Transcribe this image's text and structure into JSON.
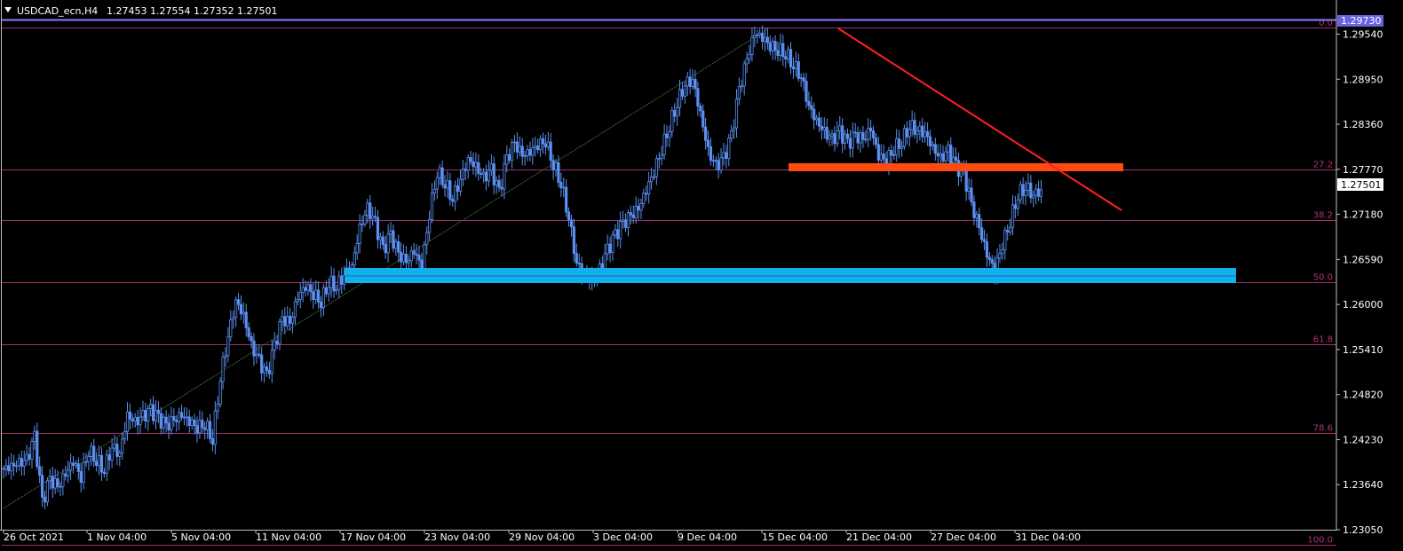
{
  "header": {
    "symbol_label": "USDCAD_ecn,H4",
    "quotes": "1.27453 1.27554 1.27352 1.27501",
    "collapse_icon": "triangle-down-icon"
  },
  "colors": {
    "background": "#000000",
    "candle": "#5b8ff0",
    "fib": "#a0306f",
    "top_line": "#8a7cff",
    "trendline": "#ff2020",
    "resistance_zone": "#ff4a10",
    "support_zone": "#12b0ee",
    "text": "#ffffff",
    "fib_text": "#b0357a",
    "current_price_box": "#ffffff",
    "top_price_box": "#6a62e0"
  },
  "chart_data": {
    "type": "candlestick",
    "symbol": "USDCAD_ecn",
    "timeframe": "H4",
    "ylim": [
      1.2285,
      1.2985
    ],
    "y_ticks": [
      "1.29540",
      "1.28950",
      "1.28360",
      "1.27770",
      "1.27180",
      "1.26590",
      "1.26000",
      "1.25410",
      "1.24820",
      "1.24230",
      "1.23640",
      "1.23050"
    ],
    "x_ticks": [
      "26 Oct 2021",
      "1 Nov 04:00",
      "5 Nov 04:00",
      "11 Nov 04:00",
      "17 Nov 04:00",
      "23 Nov 04:00",
      "29 Nov 04:00",
      "3 Dec 04:00",
      "9 Dec 04:00",
      "15 Dec 04:00",
      "21 Dec 04:00",
      "27 Dec 04:00",
      "31 Dec 04:00"
    ],
    "last_price": "1.27501",
    "top_price": "1.29730",
    "close_path": [
      [
        0,
        1.2385
      ],
      [
        3,
        1.2395
      ],
      [
        4,
        1.2425
      ],
      [
        5,
        1.234
      ],
      [
        6,
        1.237
      ],
      [
        7,
        1.236
      ],
      [
        9,
        1.2395
      ],
      [
        10,
        1.2375
      ],
      [
        11,
        1.241
      ],
      [
        13,
        1.2385
      ],
      [
        14,
        1.2415
      ],
      [
        15,
        1.2405
      ],
      [
        16,
        1.2455
      ],
      [
        17,
        1.2445
      ],
      [
        19,
        1.246
      ],
      [
        21,
        1.244
      ],
      [
        23,
        1.2455
      ],
      [
        25,
        1.244
      ],
      [
        26,
        1.2445
      ],
      [
        27,
        1.2425
      ],
      [
        28,
        1.2505
      ],
      [
        29,
        1.256
      ],
      [
        30,
        1.2605
      ],
      [
        31,
        1.2585
      ],
      [
        32,
        1.2545
      ],
      [
        33,
        1.2525
      ],
      [
        34,
        1.2505
      ],
      [
        35,
        1.2545
      ],
      [
        36,
        1.258
      ],
      [
        37,
        1.2575
      ],
      [
        38,
        1.261
      ],
      [
        39,
        1.2625
      ],
      [
        40,
        1.2615
      ],
      [
        41,
        1.2605
      ],
      [
        42,
        1.263
      ],
      [
        43,
        1.2625
      ],
      [
        44,
        1.264
      ],
      [
        45,
        1.265
      ],
      [
        46,
        1.27
      ],
      [
        47,
        1.2725
      ],
      [
        48,
        1.2705
      ],
      [
        49,
        1.267
      ],
      [
        50,
        1.269
      ],
      [
        51,
        1.2665
      ],
      [
        52,
        1.2655
      ],
      [
        53,
        1.267
      ],
      [
        54,
        1.265
      ],
      [
        55,
        1.272
      ],
      [
        56,
        1.2775
      ],
      [
        57,
        1.276
      ],
      [
        58,
        1.274
      ],
      [
        59,
        1.2765
      ],
      [
        60,
        1.279
      ],
      [
        61,
        1.278
      ],
      [
        62,
        1.2765
      ],
      [
        63,
        1.2775
      ],
      [
        64,
        1.2745
      ],
      [
        65,
        1.279
      ],
      [
        66,
        1.281
      ],
      [
        67,
        1.2795
      ],
      [
        68,
        1.28
      ],
      [
        69,
        1.281
      ],
      [
        70,
        1.2815
      ],
      [
        71,
        1.2785
      ],
      [
        72,
        1.276
      ],
      [
        73,
        1.2715
      ],
      [
        74,
        1.2655
      ],
      [
        75,
        1.264
      ],
      [
        76,
        1.263
      ],
      [
        77,
        1.2645
      ],
      [
        78,
        1.267
      ],
      [
        79,
        1.269
      ],
      [
        80,
        1.2705
      ],
      [
        81,
        1.2715
      ],
      [
        82,
        1.2725
      ],
      [
        83,
        1.275
      ],
      [
        84,
        1.2775
      ],
      [
        85,
        1.2805
      ],
      [
        86,
        1.2835
      ],
      [
        87,
        1.2865
      ],
      [
        88,
        1.289
      ],
      [
        89,
        1.2895
      ],
      [
        90,
        1.285
      ],
      [
        91,
        1.28
      ],
      [
        92,
        1.278
      ],
      [
        93,
        1.279
      ],
      [
        94,
        1.282
      ],
      [
        95,
        1.288
      ],
      [
        96,
        1.292
      ],
      [
        97,
        1.2955
      ],
      [
        98,
        1.295
      ],
      [
        99,
        1.294
      ],
      [
        100,
        1.2935
      ],
      [
        101,
        1.293
      ],
      [
        102,
        1.2915
      ],
      [
        103,
        1.29
      ],
      [
        104,
        1.286
      ],
      [
        105,
        1.284
      ],
      [
        106,
        1.2825
      ],
      [
        107,
        1.2815
      ],
      [
        108,
        1.2825
      ],
      [
        109,
        1.281
      ],
      [
        110,
        1.282
      ],
      [
        111,
        1.2815
      ],
      [
        112,
        1.283
      ],
      [
        113,
        1.2795
      ],
      [
        114,
        1.279
      ],
      [
        115,
        1.2805
      ],
      [
        116,
        1.2815
      ],
      [
        117,
        1.2835
      ],
      [
        118,
        1.283
      ],
      [
        119,
        1.2825
      ],
      [
        120,
        1.2805
      ],
      [
        121,
        1.279
      ],
      [
        122,
        1.28
      ],
      [
        123,
        1.278
      ],
      [
        124,
        1.277
      ],
      [
        125,
        1.273
      ],
      [
        126,
        1.27
      ],
      [
        127,
        1.2665
      ],
      [
        128,
        1.2645
      ],
      [
        129,
        1.268
      ],
      [
        130,
        1.271
      ],
      [
        131,
        1.2745
      ],
      [
        132,
        1.2755
      ],
      [
        133,
        1.2745
      ],
      [
        134,
        1.275
      ]
    ],
    "fib_levels": [
      {
        "label": "0.0",
        "price": 1.2973
      },
      {
        "label": "27.2",
        "price": 1.2777
      },
      {
        "label": "38.2",
        "price": 1.271
      },
      {
        "label": "50.0",
        "price": 1.2629
      },
      {
        "label": "61.8",
        "price": 1.2548
      },
      {
        "label": "78.6",
        "price": 1.2432
      },
      {
        "label": "100.0",
        "price": 1.2285
      }
    ],
    "trendline": {
      "from": [
        99,
        1.2973
      ],
      "to": [
        136,
        1.2716
      ]
    },
    "fib_diagonal": {
      "from": [
        0,
        1.2347
      ],
      "to": [
        99,
        1.2973
      ]
    },
    "resistance_zone": {
      "from": 93,
      "to": 137,
      "price_top": 1.27735,
      "price_bottom": 1.27665
    },
    "support_zone": {
      "from": 39,
      "to": 148,
      "price_top": 1.2637,
      "price_bottom": 1.2623
    }
  }
}
